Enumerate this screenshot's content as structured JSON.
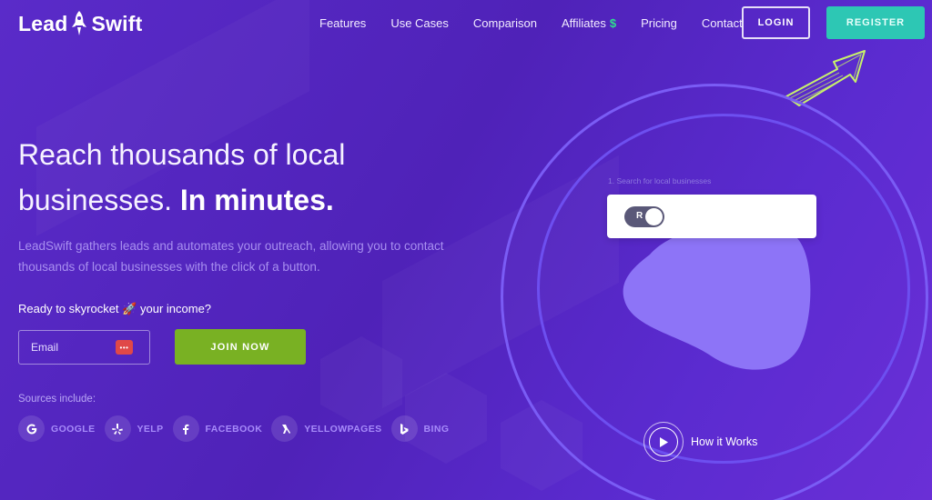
{
  "brand": {
    "name_left": "Lead",
    "name_right": "Swift"
  },
  "nav": {
    "items": [
      {
        "label": "Features"
      },
      {
        "label": "Use Cases"
      },
      {
        "label": "Comparison"
      },
      {
        "label": "Affiliates",
        "suffix": "$"
      },
      {
        "label": "Pricing"
      },
      {
        "label": "Contact"
      }
    ],
    "login": "LOGIN",
    "register": "REGISTER"
  },
  "hero": {
    "title_line1": "Reach thousands of local",
    "title_line2_normal": "businesses.",
    "title_line2_bold": "In minutes.",
    "description": "LeadSwift gathers leads and automates your outreach, allowing you to contact thousands of local businesses with the click of a button.",
    "ready_prefix": "Ready to skyrocket",
    "ready_emoji": "🚀",
    "ready_suffix": "your income?",
    "email_placeholder": "Email",
    "join_button": "JOIN NOW"
  },
  "sources": {
    "label": "Sources include:",
    "items": [
      {
        "name": "GOOGLE",
        "icon": "google-icon"
      },
      {
        "name": "YELP",
        "icon": "yelp-icon"
      },
      {
        "name": "FACEBOOK",
        "icon": "facebook-icon"
      },
      {
        "name": "YELLOWPAGES",
        "icon": "yellowpages-icon"
      },
      {
        "name": "BING",
        "icon": "bing-icon"
      }
    ]
  },
  "illustration": {
    "step_label": "1. Search for local businesses",
    "toggle_letter": "R",
    "how_it_works": "How it Works"
  },
  "colors": {
    "register": "#2dc7b4",
    "join": "#79b123",
    "ring": "#7a5cf5",
    "blob": "#8d74f7",
    "arrow": "#c8f26a"
  }
}
